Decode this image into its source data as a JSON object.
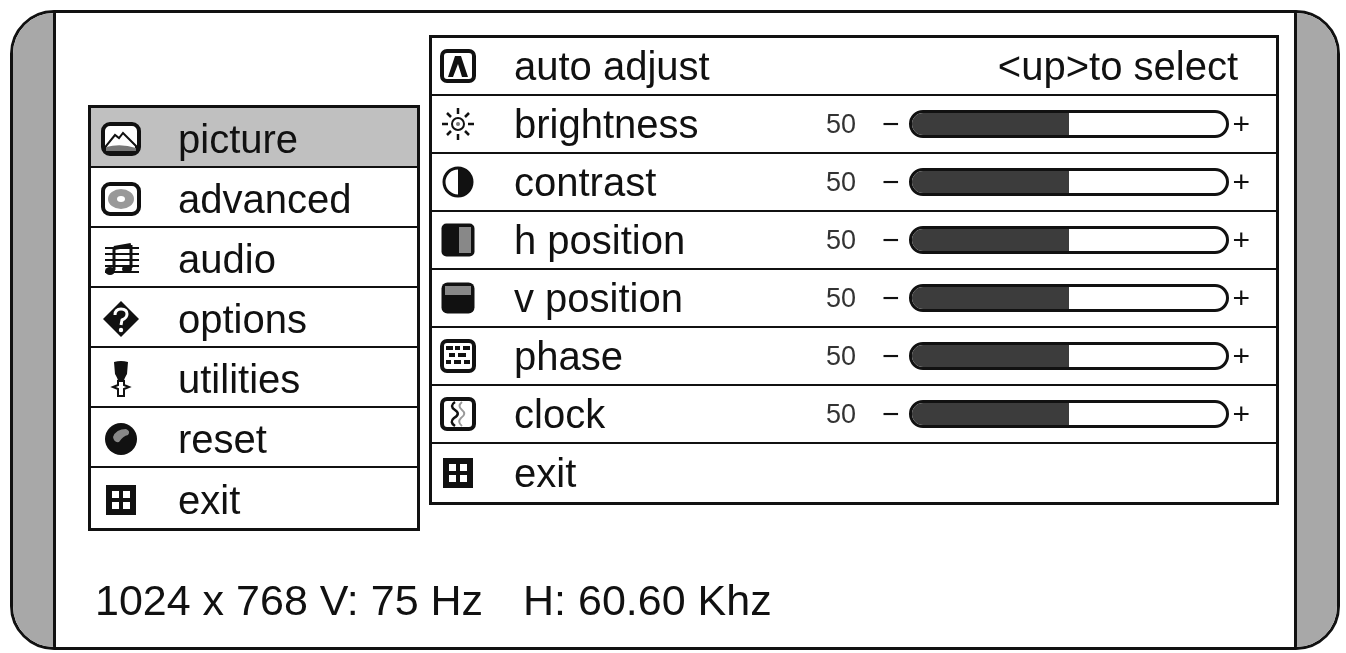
{
  "main_menu": {
    "items": [
      {
        "label": "picture",
        "selected": true
      },
      {
        "label": "advanced",
        "selected": false
      },
      {
        "label": "audio",
        "selected": false
      },
      {
        "label": "options",
        "selected": false
      },
      {
        "label": "utilities",
        "selected": false
      },
      {
        "label": "reset",
        "selected": false
      },
      {
        "label": "exit",
        "selected": false
      }
    ]
  },
  "submenu": {
    "items": [
      {
        "kind": "action",
        "label": "auto adjust",
        "hint": "<up>to select"
      },
      {
        "kind": "slider",
        "label": "brightness",
        "value": "50",
        "decrease": "−",
        "level": 0.5,
        "increase": "+"
      },
      {
        "kind": "slider",
        "label": "contrast",
        "value": "50",
        "decrease": "−",
        "level": 0.5,
        "increase": "+"
      },
      {
        "kind": "slider",
        "label": "h position",
        "value": "50",
        "decrease": "−",
        "level": 0.5,
        "increase": "+"
      },
      {
        "kind": "slider",
        "label": "v position",
        "value": "50",
        "decrease": "−",
        "level": 0.5,
        "increase": "+"
      },
      {
        "kind": "slider",
        "label": "phase",
        "value": "50",
        "decrease": "−",
        "level": 0.5,
        "increase": "+"
      },
      {
        "kind": "slider",
        "label": "clock",
        "value": "50",
        "decrease": "−",
        "level": 0.5,
        "increase": "+"
      },
      {
        "kind": "action",
        "label": "exit"
      }
    ]
  },
  "status_bar": {
    "resolution": "1024 x 768 V: 75 Hz",
    "horizontal_frequency": "H: 60.60 Khz"
  }
}
